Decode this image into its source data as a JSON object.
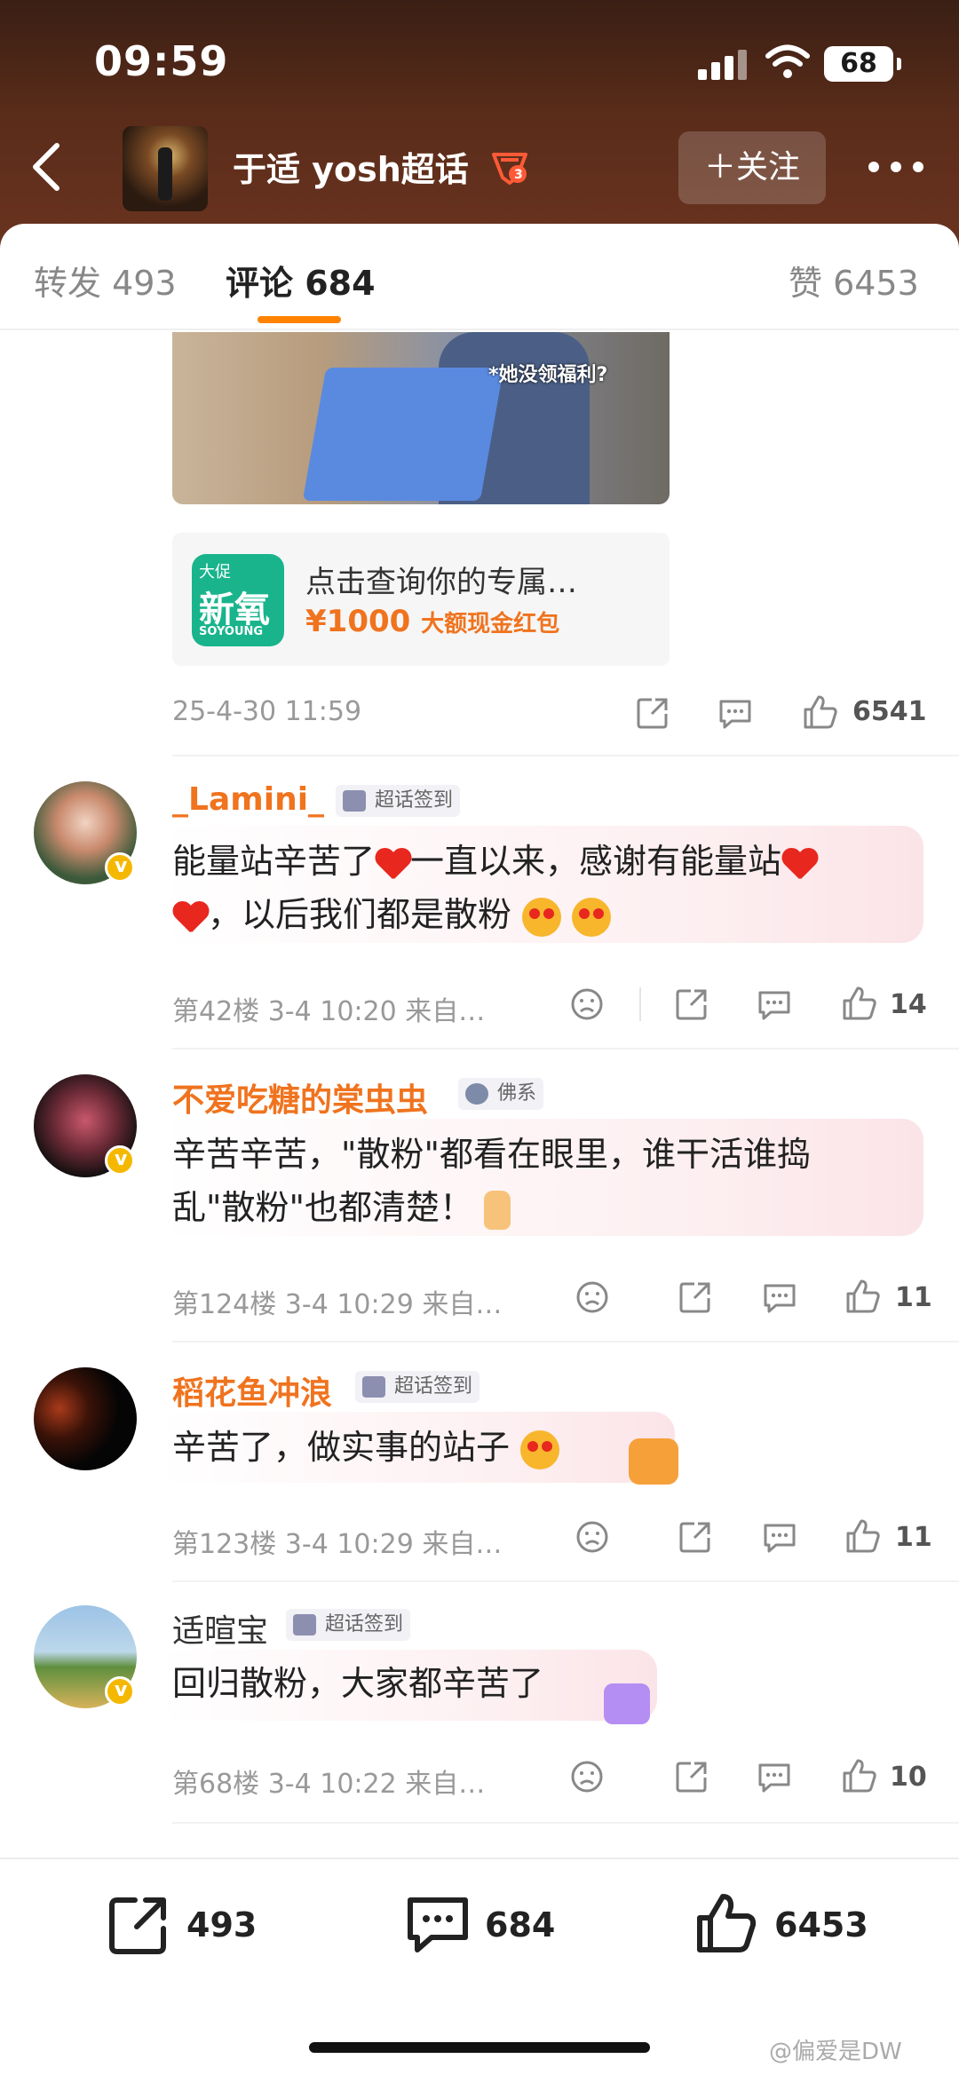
{
  "status_bar": {
    "time": "09:59",
    "battery": "68"
  },
  "header": {
    "title": "于适 yosh超话",
    "follow_label": "＋关注"
  },
  "tabs": [
    {
      "label": "转发 493"
    },
    {
      "label": "评论 684"
    },
    {
      "label": "赞 6453"
    }
  ],
  "media": {
    "caption": "*她没领福利?"
  },
  "ad": {
    "logo_line1": "大促",
    "logo_line2": "新氧",
    "logo_line3": "SOYOUNG",
    "title": "点击查询你的专属…",
    "price": "¥1000",
    "price_suffix": "大额现金红包"
  },
  "post": {
    "timestamp": "25-4-30 11:59",
    "likes": "6541"
  },
  "comments": [
    {
      "name": "_Lamini_",
      "tag": "超话签到",
      "text_a": "能量站辛苦了",
      "text_b": "一直以来，感谢有能量站",
      "text_c": "，以后我们都是散粉",
      "meta": "第42楼 3-4 10:20 来自…",
      "likes": "14"
    },
    {
      "name": "不爱吃糖的棠虫虫",
      "tag": "佛系",
      "text_a": "辛苦辛苦，\"散粉\"都看在眼里，谁干活谁捣",
      "text_b": "乱\"散粉\"也都清楚！",
      "meta": "第124楼 3-4 10:29 来自…",
      "likes": "11"
    },
    {
      "name": "稻花鱼冲浪",
      "tag": "超话签到",
      "text_a": "辛苦了，做实事的站子",
      "meta": "第123楼 3-4 10:29 来自…",
      "likes": "11"
    },
    {
      "name": "适暄宝",
      "tag": "超话签到",
      "text_a": "回归散粉，大家都辛苦了",
      "meta": "第68楼 3-4 10:22 来自…",
      "likes": "10"
    }
  ],
  "bottom_bar": {
    "reposts": "493",
    "comments": "684",
    "likes": "6453"
  },
  "watermark": "@偏爱是DW",
  "colors": {
    "accent": "#ff8200",
    "name": "#f0731e",
    "header": "#5a2c1a"
  }
}
